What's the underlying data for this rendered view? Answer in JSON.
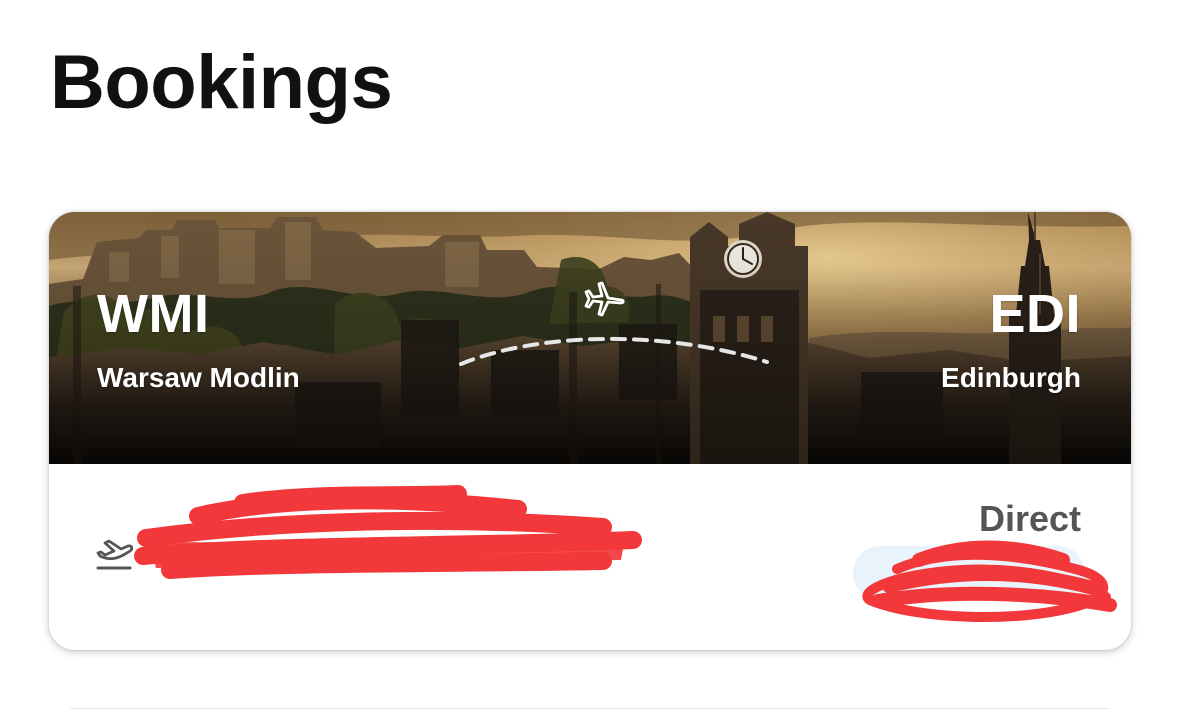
{
  "page": {
    "title": "Bookings"
  },
  "booking": {
    "origin": {
      "code": "WMI",
      "name": "Warsaw Modlin"
    },
    "destination": {
      "code": "EDI",
      "name": "Edinburgh"
    },
    "route_icon": "airplane-icon",
    "departure_icon": "flight-takeoff-icon",
    "stops": "Direct"
  },
  "colors": {
    "title": "#111111",
    "hero_text": "#ffffff",
    "stops_text": "#555555",
    "redaction": "#f2383a",
    "pill": "#e9f3fb"
  }
}
